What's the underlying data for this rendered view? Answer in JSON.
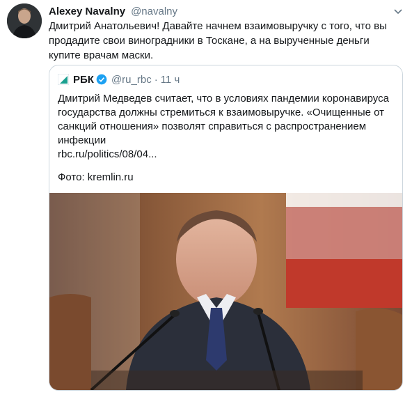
{
  "tweet": {
    "author_name": "Alexey Navalny",
    "author_handle": "@navalny",
    "text": "Дмитрий Анатольевич! Давайте начнем взаимовыручку с того, что вы продадите свои виноградники в Тоскане, а на вырученные деньги купите врачам маски."
  },
  "quote": {
    "name": "РБК",
    "handle": "@ru_rbc",
    "separator": "·",
    "time": "11 ч",
    "text": "Дмитрий Медведев считает, что в условиях пандемии коронавируса государства должны стремиться к взаимовыручке. «Очищенные от санкций отношения» позволят справиться с распространением инфекции",
    "link": "rbc.ru/politics/08/04...",
    "photo_credit": "Фото: kremlin.ru"
  },
  "icons": {
    "caret": "chevron-down-icon",
    "verified": "verified-badge-icon",
    "rbc_logo": "rbc-logo-icon"
  },
  "colors": {
    "text": "#14171a",
    "secondary": "#657786",
    "verified": "#1da1f2",
    "border": "#ccd6dd"
  }
}
